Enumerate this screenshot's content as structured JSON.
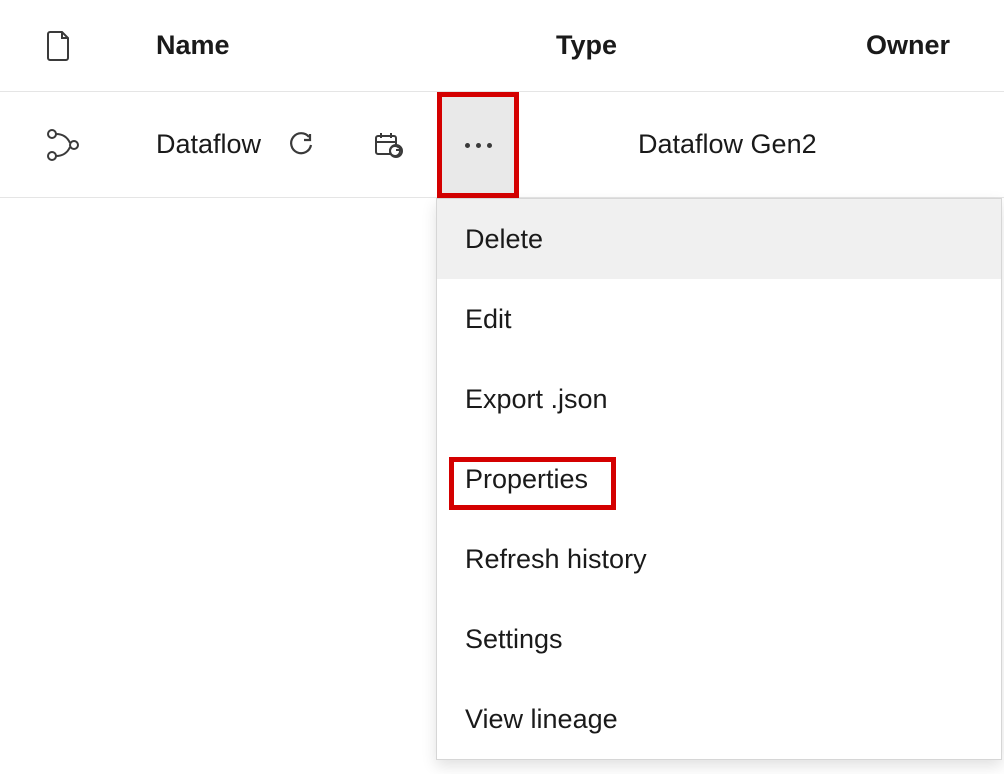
{
  "table": {
    "headers": {
      "name": "Name",
      "type": "Type",
      "owner": "Owner"
    },
    "row": {
      "name": "Dataflow",
      "type": "Dataflow Gen2",
      "icons": {
        "item": "dataflow-icon",
        "refresh": "refresh-icon",
        "schedule": "schedule-refresh-icon",
        "more": "more-icon"
      }
    }
  },
  "menu": {
    "items": [
      {
        "label": "Delete",
        "hover": true
      },
      {
        "label": "Edit",
        "hover": false
      },
      {
        "label": "Export .json",
        "hover": false
      },
      {
        "label": "Properties",
        "hover": false,
        "highlighted": true
      },
      {
        "label": "Refresh history",
        "hover": false
      },
      {
        "label": "Settings",
        "hover": false
      },
      {
        "label": "View lineage",
        "hover": false
      }
    ]
  }
}
